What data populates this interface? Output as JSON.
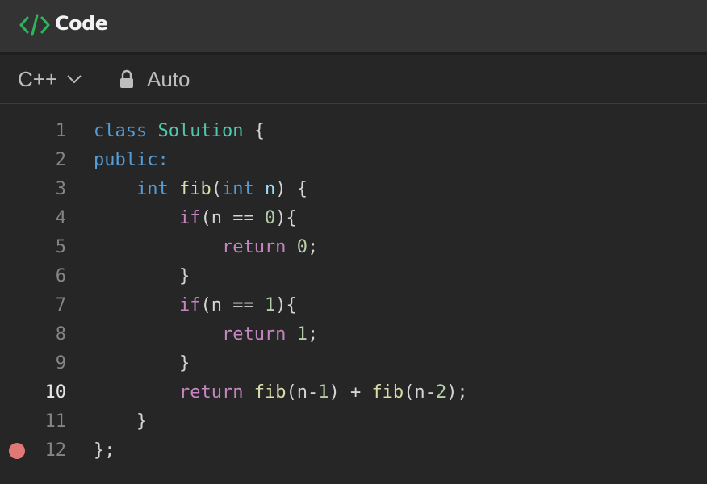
{
  "header": {
    "title": "Code",
    "icon": "code-brackets-icon",
    "icon_color": "#2db55d"
  },
  "toolbar": {
    "language": "C++",
    "mode_label": "Auto",
    "lock_icon": "lock-icon"
  },
  "editor": {
    "active_line": 10,
    "breakpoint_line": 12,
    "lines": [
      {
        "num": "1",
        "tokens": [
          {
            "t": "class",
            "c": "kw"
          },
          {
            "t": " ",
            "c": "plain"
          },
          {
            "t": "Solution",
            "c": "type"
          },
          {
            "t": " {",
            "c": "plain"
          }
        ]
      },
      {
        "num": "2",
        "tokens": [
          {
            "t": "public:",
            "c": "kw"
          }
        ]
      },
      {
        "num": "3",
        "tokens": [
          {
            "t": "    ",
            "c": "plain"
          },
          {
            "t": "int",
            "c": "kw"
          },
          {
            "t": " ",
            "c": "plain"
          },
          {
            "t": "fib",
            "c": "fn"
          },
          {
            "t": "(",
            "c": "plain"
          },
          {
            "t": "int",
            "c": "kw"
          },
          {
            "t": " ",
            "c": "plain"
          },
          {
            "t": "n",
            "c": "var"
          },
          {
            "t": ") {",
            "c": "plain"
          }
        ]
      },
      {
        "num": "4",
        "tokens": [
          {
            "t": "        ",
            "c": "plain"
          },
          {
            "t": "if",
            "c": "ctrl"
          },
          {
            "t": "(n == ",
            "c": "plain"
          },
          {
            "t": "0",
            "c": "num"
          },
          {
            "t": "){",
            "c": "plain"
          }
        ]
      },
      {
        "num": "5",
        "tokens": [
          {
            "t": "            ",
            "c": "plain"
          },
          {
            "t": "return",
            "c": "ctrl"
          },
          {
            "t": " ",
            "c": "plain"
          },
          {
            "t": "0",
            "c": "num"
          },
          {
            "t": ";",
            "c": "plain"
          }
        ]
      },
      {
        "num": "6",
        "tokens": [
          {
            "t": "        }",
            "c": "plain"
          }
        ]
      },
      {
        "num": "7",
        "tokens": [
          {
            "t": "        ",
            "c": "plain"
          },
          {
            "t": "if",
            "c": "ctrl"
          },
          {
            "t": "(n == ",
            "c": "plain"
          },
          {
            "t": "1",
            "c": "num"
          },
          {
            "t": "){",
            "c": "plain"
          }
        ]
      },
      {
        "num": "8",
        "tokens": [
          {
            "t": "            ",
            "c": "plain"
          },
          {
            "t": "return",
            "c": "ctrl"
          },
          {
            "t": " ",
            "c": "plain"
          },
          {
            "t": "1",
            "c": "num"
          },
          {
            "t": ";",
            "c": "plain"
          }
        ]
      },
      {
        "num": "9",
        "tokens": [
          {
            "t": "        }",
            "c": "plain"
          }
        ]
      },
      {
        "num": "10",
        "tokens": [
          {
            "t": "        ",
            "c": "plain"
          },
          {
            "t": "return",
            "c": "ctrl"
          },
          {
            "t": " ",
            "c": "plain"
          },
          {
            "t": "fib",
            "c": "fn"
          },
          {
            "t": "(n-",
            "c": "plain"
          },
          {
            "t": "1",
            "c": "num"
          },
          {
            "t": ") + ",
            "c": "plain"
          },
          {
            "t": "fib",
            "c": "fn"
          },
          {
            "t": "(n-",
            "c": "plain"
          },
          {
            "t": "2",
            "c": "num"
          },
          {
            "t": ");",
            "c": "plain"
          }
        ]
      },
      {
        "num": "11",
        "tokens": [
          {
            "t": "    }",
            "c": "plain"
          }
        ]
      },
      {
        "num": "12",
        "tokens": [
          {
            "t": "};",
            "c": "plain"
          }
        ]
      }
    ]
  }
}
